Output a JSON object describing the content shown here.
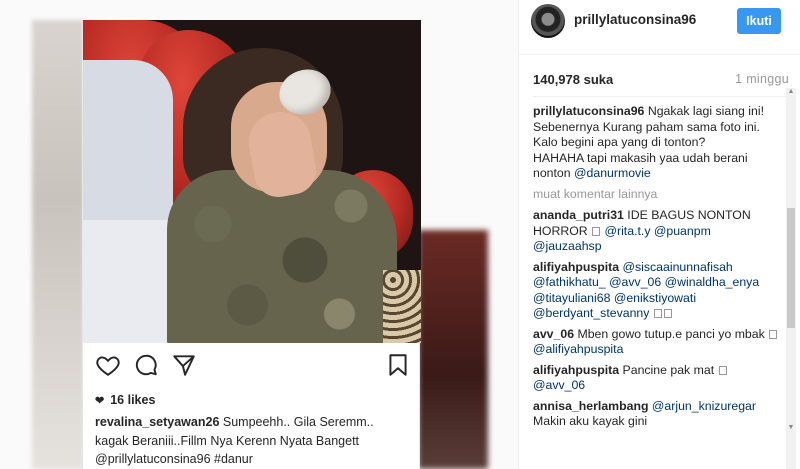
{
  "left_post": {
    "likes": "16 likes",
    "caption_user": "revalina_setyawan26",
    "caption_line1": " Sumpeehh.. Gila Seremm..",
    "caption_line2": "kagak Beraniii..Fillm Nya Kerenn Nyata Bangett",
    "caption_mention": "@prillylatuconsina96",
    "caption_tag": " #danur"
  },
  "side": {
    "username": "prillylatuconsina96",
    "follow_label": "Ikuti",
    "likes": "140,978 suka",
    "posted_ago": "1 minggu",
    "caption_user": "prillylatuconsina96",
    "caption_text": " Ngakak lagi siang ini! Sebenernya Kurang paham sama foto ini.",
    "caption_line2": "Kalo begini apa yang di tonton?",
    "caption_line3": "HAHAHA tapi makasih yaa udah berani nonton ",
    "caption_mention": "@danurmovie",
    "load_more": "muat komentar lainnya",
    "comments": [
      {
        "user": "ananda_putri31",
        "text": " IDE BAGUS NONTON HORROR ",
        "text2": " ",
        "m1": "@rita.t.y",
        "m2": " @puanpm",
        "m3": "@jauzaahsp"
      },
      {
        "user": "alifiyahpuspita",
        "m1": " @siscaainunnafisah",
        "m2": "@fathikhatu_",
        "m3": " @avv_06",
        "m4": " @winaldha_enya",
        "m5": "@titayuliani68",
        "m6": " @enikstiyowati",
        "m7": "@berdyant_stevanny"
      },
      {
        "user": "avv_06",
        "text": " Mben gowo tutup.e panci yo mbak ",
        "m1": "@alifiyahpuspita"
      },
      {
        "user": "alifiyahpuspita",
        "text": " Pancine pak mat ",
        "m1": "@avv_06"
      },
      {
        "user": "annisa_herlambang",
        "m1": " @arjun_knizuregar",
        "text": "Makin aku kayak gini"
      }
    ]
  },
  "icons": {
    "heart": "heart-icon",
    "comment": "comment-icon",
    "share": "send-icon",
    "bookmark": "bookmark-icon"
  }
}
